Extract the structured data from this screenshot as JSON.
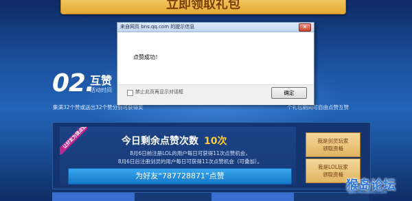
{
  "page": {
    "top_button_label": "立即领取礼包",
    "section": {
      "number": "02.",
      "title": "互赞",
      "subtitle": "活动时间",
      "desc_left": "集满32个赞或送出32个赞分别可获得奖",
      "desc_right": "个礼包期间可自由点赞互赞"
    },
    "panel": {
      "ribbon": "让好友为我点赞",
      "count_title": "今日剩余点赞次数",
      "count_value": "10次",
      "rule_1": "8月6日前注册LOL的用户每日可获得11次点赞机会，",
      "rule_2": "8月6日后注册剑灵的用户每日可获得11次点赞机会（可叠加）。",
      "like_button": "为好友“787728871”点赞",
      "side_button_a": "我是剑灵玩家\n领取资格",
      "side_button_b": "我是LOL玩家\n领取资格"
    },
    "watermark": "猴岛论坛",
    "watermark_sub": "BBS.HOUDAO.COM"
  },
  "dialog": {
    "title": "来自网页 bns.qq.com 的提示信息",
    "close_label": "✕",
    "message": "点赞成功！",
    "checkbox_label": "禁止此页再显示对话框",
    "ok_label": "确定"
  },
  "colors": {
    "accent_gold": "#e2a934",
    "button_blue": "#1677c9",
    "ribbon_pink": "#c0278d",
    "count_yellow": "#ffcc33"
  }
}
